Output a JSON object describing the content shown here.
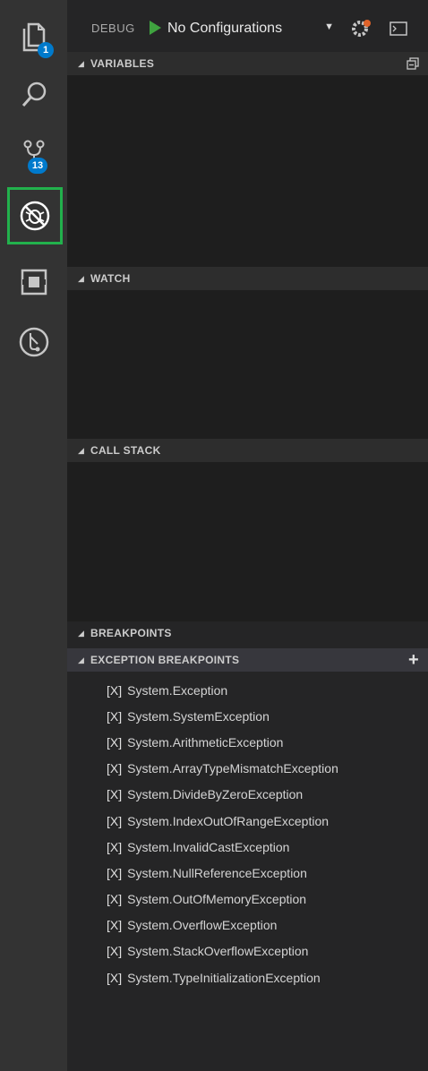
{
  "activity_bar": {
    "explorer_badge": "1",
    "scm_badge": "13"
  },
  "debug": {
    "label": "DEBUG",
    "configuration": "No Configurations"
  },
  "sections": {
    "variables": "VARIABLES",
    "watch": "WATCH",
    "call_stack": "CALL STACK",
    "breakpoints": "BREAKPOINTS",
    "exception_breakpoints": "EXCEPTION BREAKPOINTS"
  },
  "exceptions": [
    {
      "check": "[X]",
      "label": "System.Exception"
    },
    {
      "check": "[X]",
      "label": "System.SystemException"
    },
    {
      "check": "[X]",
      "label": "System.ArithmeticException"
    },
    {
      "check": "[X]",
      "label": "System.ArrayTypeMismatchException"
    },
    {
      "check": "[X]",
      "label": "System.DivideByZeroException"
    },
    {
      "check": "[X]",
      "label": "System.IndexOutOfRangeException"
    },
    {
      "check": "[X]",
      "label": "System.InvalidCastException"
    },
    {
      "check": "[X]",
      "label": "System.NullReferenceException"
    },
    {
      "check": "[X]",
      "label": "System.OutOfMemoryException"
    },
    {
      "check": "[X]",
      "label": "System.OverflowException"
    },
    {
      "check": "[X]",
      "label": "System.StackOverflowException"
    },
    {
      "check": "[X]",
      "label": "System.TypeInitializationException"
    }
  ],
  "colors": {
    "activity_bar": "#333333",
    "active_highlight": "#22b14c",
    "badge": "#007acc",
    "play": "#3fa33f"
  }
}
